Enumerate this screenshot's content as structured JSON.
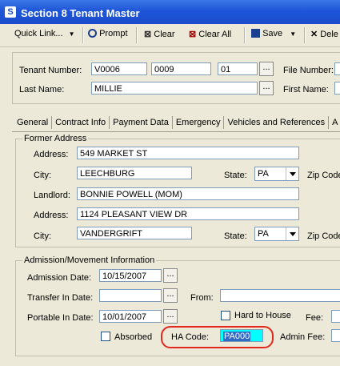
{
  "window": {
    "title": "Section 8 Tenant Master"
  },
  "toolbar": {
    "quick_link": "Quick Link...",
    "prompt": "Prompt",
    "clear": "Clear",
    "clear_all": "Clear All",
    "save": "Save",
    "delete": "Dele"
  },
  "header": {
    "tenant_number_label": "Tenant Number:",
    "tenant_number_1": "V0006",
    "tenant_number_2": "0009",
    "tenant_number_3": "01",
    "file_number_label": "File Number:",
    "last_name_label": "Last Name:",
    "last_name": "MILLIE",
    "first_name_label": "First Name:"
  },
  "tabs": [
    "General",
    "Contract Info",
    "Payment Data",
    "Emergency",
    "Vehicles and References",
    "A"
  ],
  "former_address": {
    "title": "Former Address",
    "address_label": "Address:",
    "address": "549 MARKET ST",
    "city_label": "City:",
    "city": "LEECHBURG",
    "state_label": "State:",
    "state": "PA",
    "zip_label": "Zip Code",
    "landlord_label": "Landlord:",
    "landlord": "BONNIE POWELL (MOM)",
    "address2_label": "Address:",
    "address2": "1124 PLEASANT VIEW DR",
    "city2_label": "City:",
    "city2": "VANDERGRIFT",
    "state2_label": "State:",
    "state2": "PA",
    "zip2_label": "Zip Code"
  },
  "admission": {
    "title": "Admission/Movement Information",
    "admission_date_label": "Admission Date:",
    "admission_date": "10/15/2007",
    "transfer_in_label": "Transfer In Date:",
    "transfer_in": "",
    "from_label": "From:",
    "from": "",
    "portable_in_label": "Portable In Date:",
    "portable_in": "10/01/2007",
    "hard_to_house_label": "Hard to House",
    "fee_label": "Fee:",
    "absorbed_label": "Absorbed",
    "ha_code_label": "HA Code:",
    "ha_code": "PA000",
    "admin_fee_label": "Admin Fee:"
  },
  "colors": {
    "title_blue": "#1a4ccc",
    "highlight_circle": "#e0281c",
    "field_highlight": "#00ffff"
  }
}
